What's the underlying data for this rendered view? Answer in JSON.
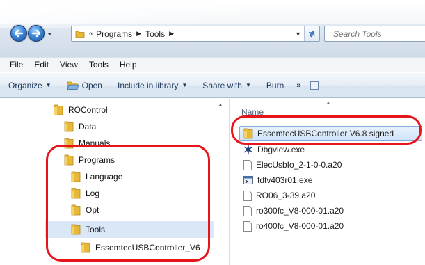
{
  "address": {
    "overflow": "«",
    "crumbs": [
      "Programs",
      "Tools"
    ]
  },
  "search": {
    "placeholder": "Search Tools"
  },
  "menu": [
    "File",
    "Edit",
    "View",
    "Tools",
    "Help"
  ],
  "toolbar": {
    "organize": "Organize",
    "open": "Open",
    "include": "Include in library",
    "share": "Share with",
    "burn": "Burn",
    "more": "»"
  },
  "nav": {
    "items": [
      {
        "label": "ROControl"
      },
      {
        "label": "Data"
      },
      {
        "label": "Manuals"
      },
      {
        "label": "Programs"
      },
      {
        "label": "Language"
      },
      {
        "label": "Log"
      },
      {
        "label": "Opt"
      },
      {
        "label": "Tools"
      },
      {
        "label": "EssemtecUSBController_V6"
      }
    ]
  },
  "files": {
    "column": "Name",
    "items": [
      {
        "name": "EssemtecUSBController V6.8 signed",
        "icon": "folder-icon"
      },
      {
        "name": "Dbgview.exe",
        "icon": "dbgview-exe-icon"
      },
      {
        "name": "ElecUsbIo_2-1-0-0.a20",
        "icon": "document-icon"
      },
      {
        "name": "fdtv403r01.exe",
        "icon": "exe-icon"
      },
      {
        "name": "RO06_3-39.a20",
        "icon": "document-icon"
      },
      {
        "name": "ro300fc_V8-000-01.a20",
        "icon": "document-icon"
      },
      {
        "name": "ro400fc_V8-000-01.a20",
        "icon": "document-icon"
      }
    ]
  },
  "colors": {
    "annotation_ring": "#e8141c",
    "folder": "#e8b838",
    "selection": "#d9e7f7"
  }
}
